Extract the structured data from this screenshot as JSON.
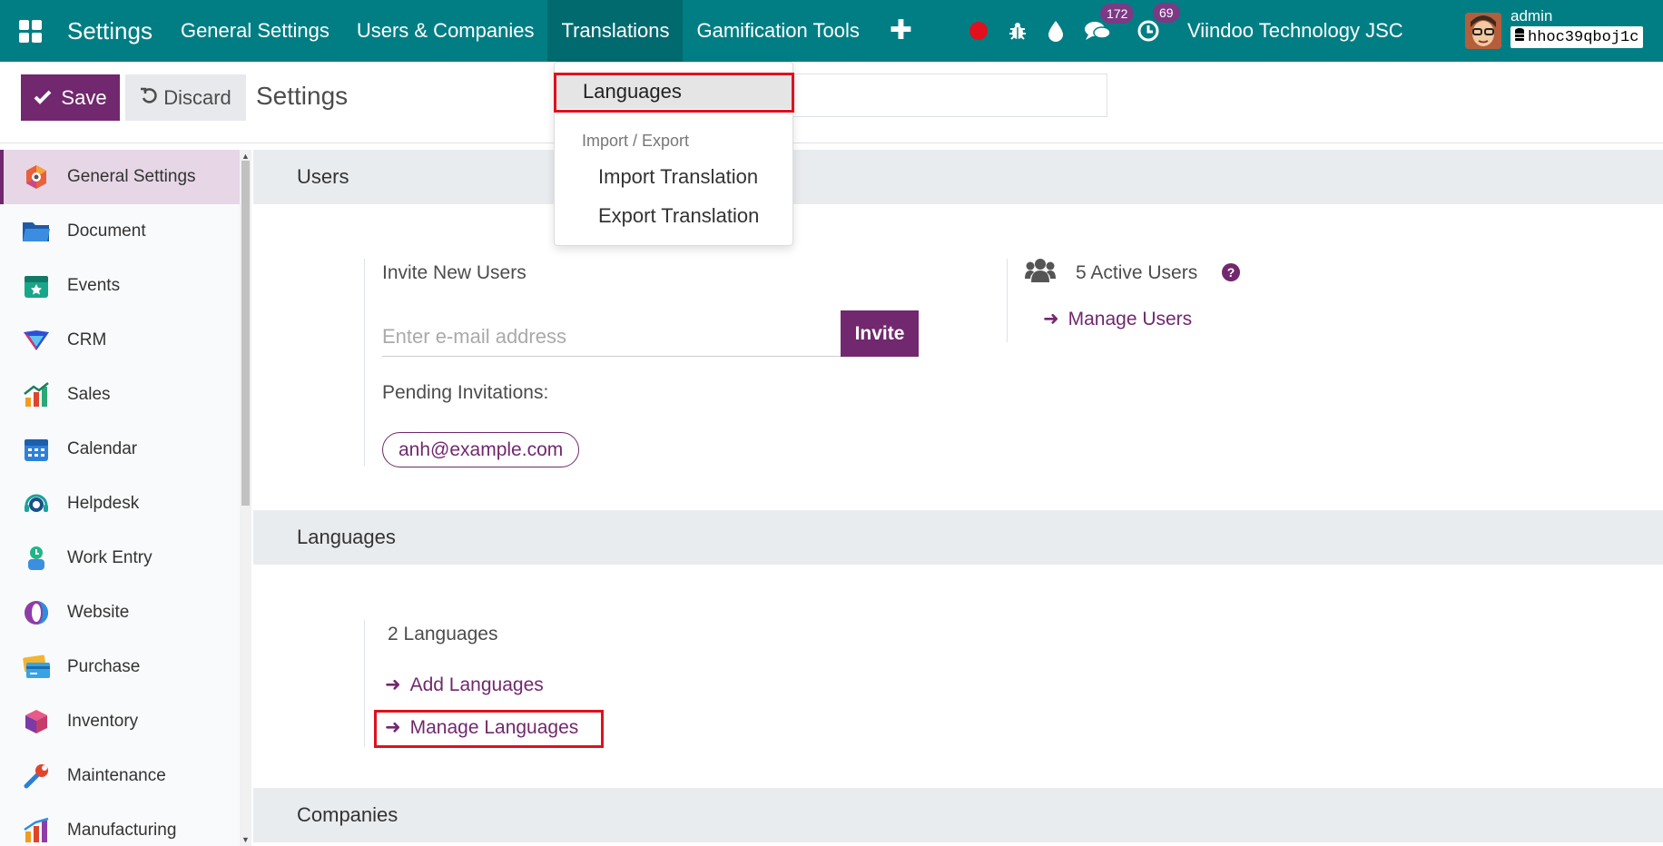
{
  "navbar": {
    "brand": "Settings",
    "menus": [
      "General Settings",
      "Users & Companies",
      "Translations",
      "Gamification Tools"
    ],
    "active_menu": "Translations",
    "plus": "✚",
    "discuss_badge": "172",
    "activity_badge": "69",
    "company": "Viindoo Technology JSC",
    "user": "admin",
    "database": "hhoc39qboj1c"
  },
  "control_panel": {
    "save_label": "Save",
    "discard_label": "Discard",
    "title": "Settings"
  },
  "dropdown": {
    "active_item": "Languages",
    "header": "Import / Export",
    "items": [
      "Import Translation",
      "Export Translation"
    ]
  },
  "sidebar": {
    "items": [
      {
        "label": "General Settings",
        "icon": "settings-icon",
        "active": true
      },
      {
        "label": "Document",
        "icon": "folder-icon"
      },
      {
        "label": "Events",
        "icon": "calendar-star-icon"
      },
      {
        "label": "CRM",
        "icon": "crm-icon"
      },
      {
        "label": "Sales",
        "icon": "sales-chart-icon"
      },
      {
        "label": "Calendar",
        "icon": "calendar-icon"
      },
      {
        "label": "Helpdesk",
        "icon": "headset-icon"
      },
      {
        "label": "Work Entry",
        "icon": "clock-person-icon"
      },
      {
        "label": "Website",
        "icon": "website-icon"
      },
      {
        "label": "Purchase",
        "icon": "credit-card-icon"
      },
      {
        "label": "Inventory",
        "icon": "box-icon"
      },
      {
        "label": "Maintenance",
        "icon": "wrench-icon"
      },
      {
        "label": "Manufacturing",
        "icon": "factory-chart-icon"
      }
    ]
  },
  "users_section": {
    "title": "Users",
    "invite_heading": "Invite New Users",
    "email_placeholder": "Enter e-mail address",
    "invite_label": "Invite",
    "pending_label": "Pending Invitations:",
    "pending_email": "anh@example.com",
    "active_users": "5 Active Users",
    "manage_users": "Manage Users"
  },
  "languages_section": {
    "title": "Languages",
    "count": "2 Languages",
    "add": "Add Languages",
    "manage": "Manage Languages"
  },
  "companies_section": {
    "title": "Companies"
  },
  "colors": {
    "navbar": "#017e84",
    "primary": "#71286e",
    "highlight": "#e0101e"
  }
}
